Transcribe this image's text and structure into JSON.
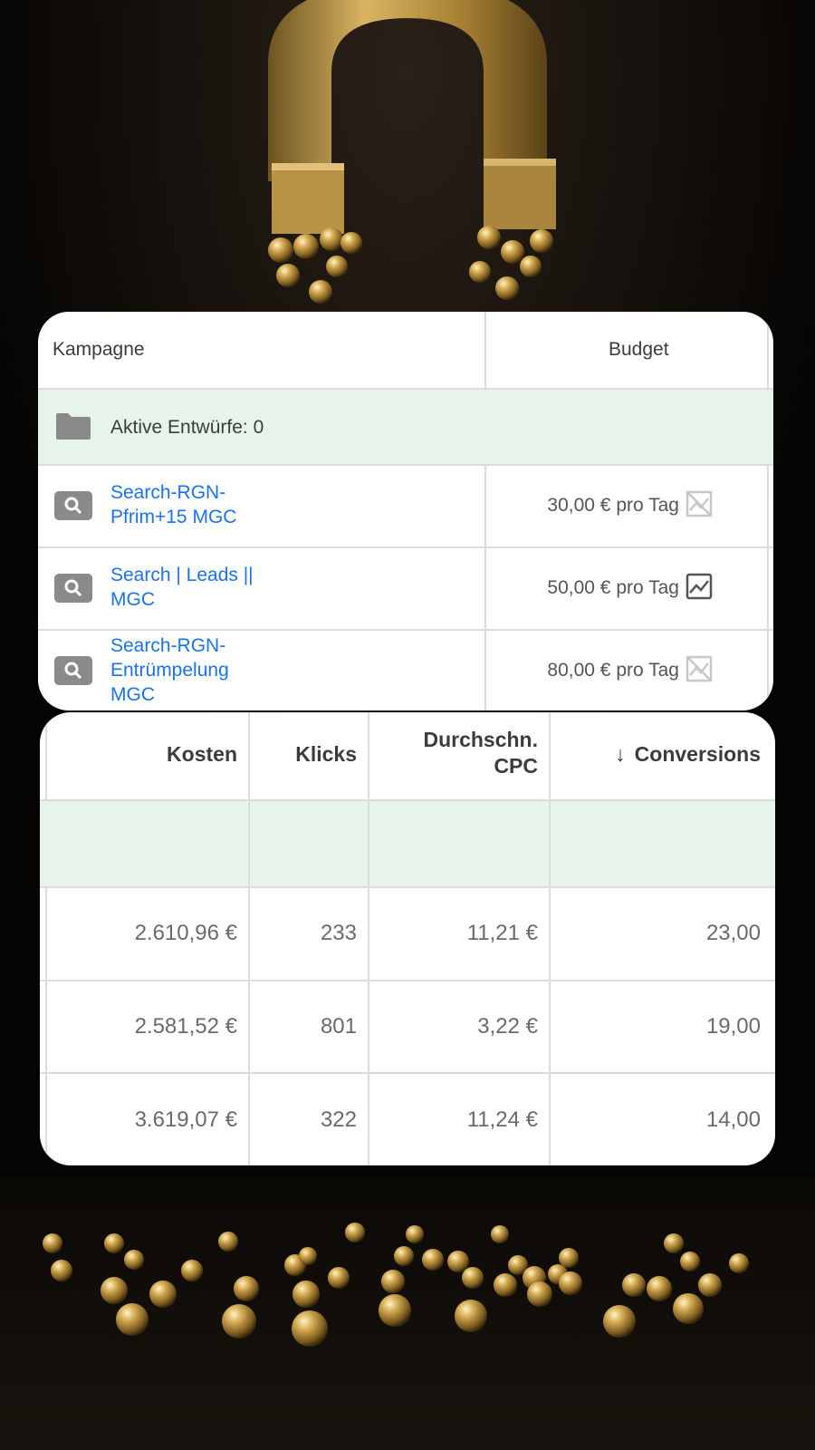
{
  "table_top": {
    "header": {
      "campaign": "Kampagne",
      "budget": "Budget"
    },
    "drafts": {
      "label": "Aktive Entwürfe:",
      "count": "0"
    },
    "rows": [
      {
        "name": "Search-RGN-\nPfrim+15 MGC",
        "budget": "30,00 € pro Tag",
        "trend_icon": "chart-disabled-icon"
      },
      {
        "name": "Search | Leads ||\nMGC",
        "budget": "50,00 € pro Tag",
        "trend_icon": "chart-trend-icon"
      },
      {
        "name": "Search-RGN-\nEntrümpelung\nMGC",
        "budget": "80,00 € pro Tag",
        "trend_icon": "chart-disabled-icon"
      }
    ]
  },
  "table_bottom": {
    "headers": {
      "costs": "Kosten",
      "clicks": "Klicks",
      "cpc_line1": "Durchschn.",
      "cpc_line2": "CPC",
      "sort_arrow": "↓",
      "conversions": "Conversions"
    },
    "rows": [
      {
        "costs": "2.610,96 €",
        "clicks": "233",
        "cpc": "11,21 €",
        "conversions": "23,00"
      },
      {
        "costs": "2.581,52 €",
        "clicks": "801",
        "cpc": "3,22 €",
        "conversions": "19,00"
      },
      {
        "costs": "3.619,07 €",
        "clicks": "322",
        "cpc": "11,24 €",
        "conversions": "14,00"
      }
    ]
  },
  "colors": {
    "link": "#1a73e8",
    "draft_row": "#e6f4ea",
    "background": "#050403",
    "gold": "#c9a24a"
  }
}
